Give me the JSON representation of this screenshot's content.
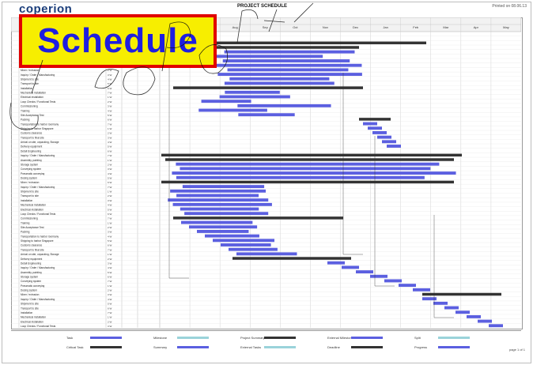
{
  "header": {
    "logo": "coperion",
    "title": "PROJECT SCHEDULE",
    "print_date": "Printed on 08.06.13",
    "badge": "Schedule"
  },
  "colors": {
    "task_bar": "#5b5fe0",
    "summary_bar": "#333333",
    "badge_bg": "#f7ee00",
    "badge_border": "#e00000",
    "badge_text": "#1f1ee0"
  },
  "schedule": {
    "visible_labels": [
      "Delivery equipment",
      "Detail Engineering",
      "Inquiry / Order / Manufacturing",
      "Assembly, painting",
      "Storage system",
      "Conveying system",
      "Pneumatic conveying",
      "Dosing system",
      "Mixer / extrusion",
      "Inquiry / Order / Manufacturing",
      "Shipment to site",
      "Transport to site",
      "Installation",
      "Mechanical installation",
      "Electrical installation",
      "Loop Checks / Functional Tests",
      "Commissioning",
      "Training",
      "Site Acceptance Test",
      "Packing",
      "Transportation to harbor Germany",
      "Shipping to harbor Singapore",
      "Customs clearance",
      "Transport to final site",
      "Arrival on site, unpacking, Storage"
    ],
    "project_months": [
      "Jun",
      "Jul",
      "Aug",
      "Sep",
      "Oct",
      "Nov",
      "Dec",
      "Jan",
      "Feb",
      "Mar",
      "Apr",
      "May"
    ]
  },
  "legend": {
    "items": [
      "Task",
      "Critical Task",
      "Milestone",
      "Summary",
      "Project Summary",
      "External Tasks",
      "External Milestone",
      "Deadline",
      "Split",
      "Progress"
    ]
  },
  "footer": {
    "page_number": "page 1 of 1"
  }
}
